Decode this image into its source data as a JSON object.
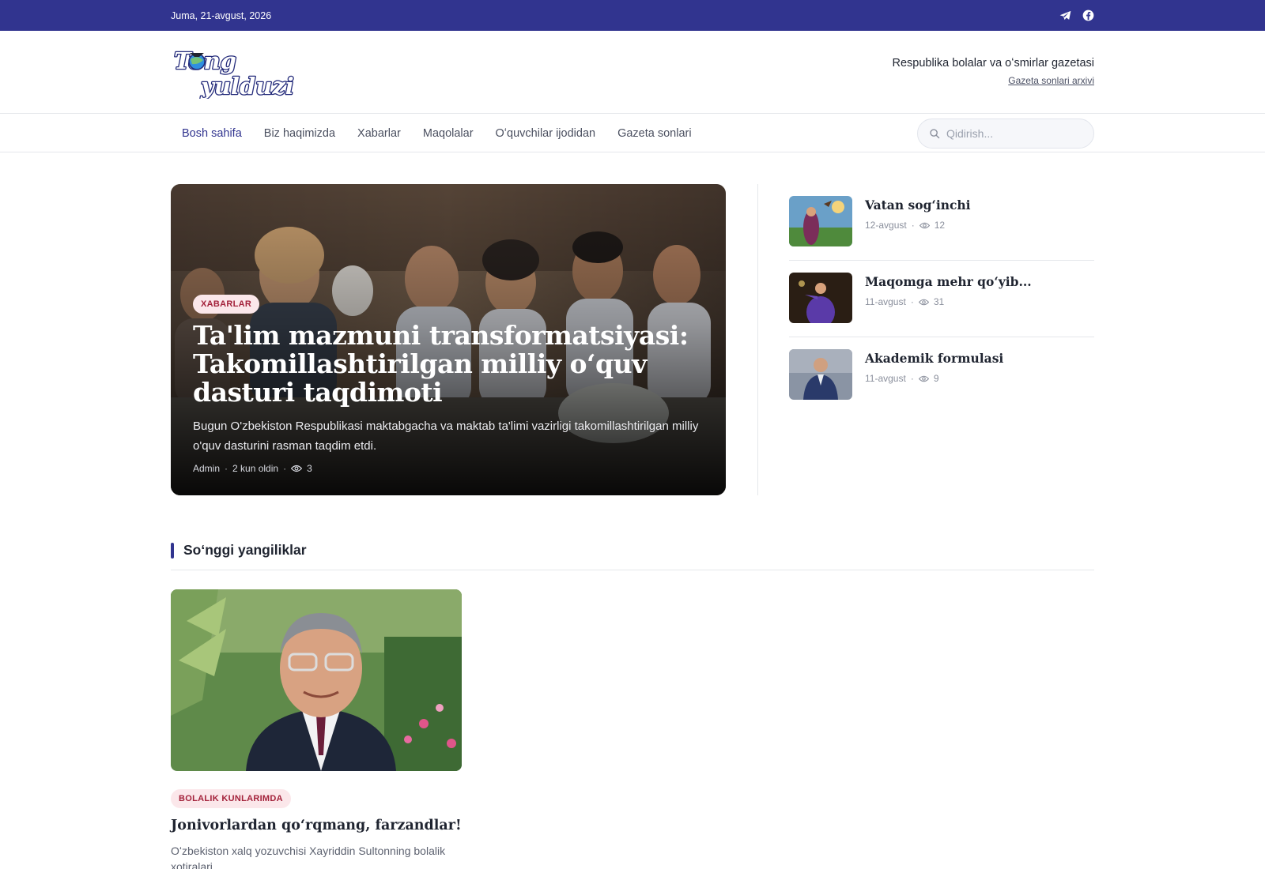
{
  "topbar": {
    "date": "Juma, 21-avgust, 2026",
    "icons": [
      "telegram-icon",
      "facebook-icon"
    ]
  },
  "masthead": {
    "logo_text": [
      "Tong",
      "yulduzi"
    ],
    "tagline": "Respublika bolalar va oʻsmirlar gazetasi",
    "archive_link": "Gazeta sonlari arxivi"
  },
  "nav": {
    "items": [
      {
        "label": "Bosh sahifa",
        "active": true
      },
      {
        "label": "Biz haqimizda"
      },
      {
        "label": "Xabarlar"
      },
      {
        "label": "Maqolalar"
      },
      {
        "label": "Oʻquvchilar ijodidan"
      },
      {
        "label": "Gazeta sonlari"
      }
    ],
    "search_placeholder": "Qidirish..."
  },
  "hero": {
    "category": "XABARLAR",
    "title": "Ta'lim mazmuni transformatsiyasi: Takomillashtirilgan milliy oʻquv dasturi taqdimoti",
    "lead": "Bugun O'zbekiston Respublikasi maktabgacha va maktab ta'limi vazirligi takomillashtirilgan milliy o'quv dasturini rasman taqdim etdi.",
    "author": "Admin",
    "time": "2 kun oldin",
    "views": "3"
  },
  "sidebar": {
    "items": [
      {
        "title": "Vatan sogʻinchi",
        "date": "12-avgust",
        "views": "12"
      },
      {
        "title": "Maqomga mehr qoʻyib...",
        "date": "11-avgust",
        "views": "31"
      },
      {
        "title": "Akademik formulasi",
        "date": "11-avgust",
        "views": "9"
      }
    ]
  },
  "latest": {
    "heading": "Soʻnggi yangiliklar",
    "cards": [
      {
        "category": "BOLALIK KUNLARIMDA",
        "title": "Jonivorlardan qoʻrqmang, farzandlar!",
        "lead": "Oʻzbekiston xalq yozuvchisi Xayriddin Sultonning bolalik xotiralari"
      }
    ]
  },
  "colors": {
    "brand": "#31348f",
    "badge_bg": "#fbe7ea",
    "badge_text": "#a3213a"
  }
}
